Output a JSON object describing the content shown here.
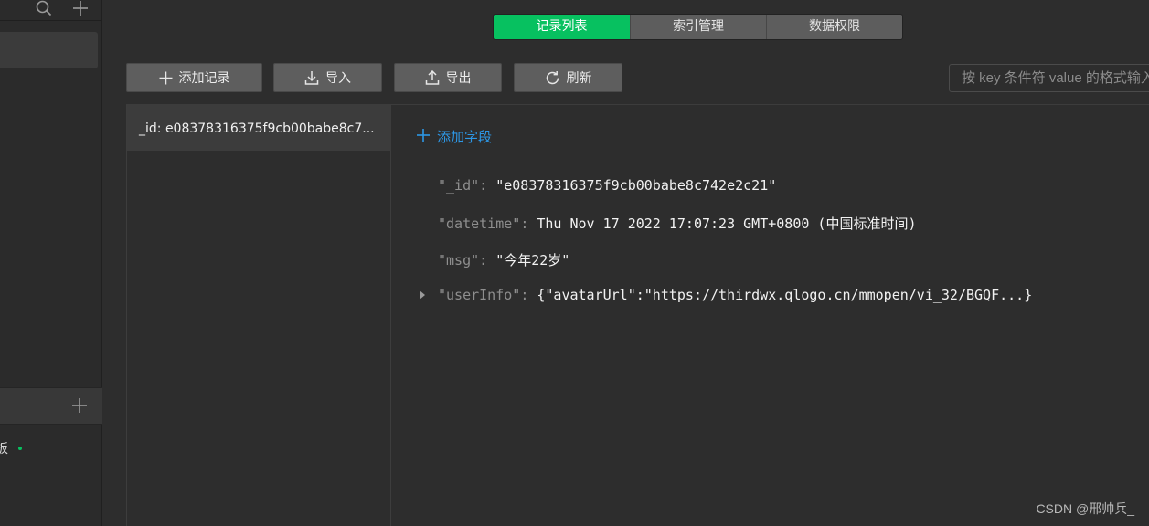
{
  "tabs": [
    {
      "label": "记录列表",
      "active": true
    },
    {
      "label": "索引管理",
      "active": false
    },
    {
      "label": "数据权限",
      "active": false
    }
  ],
  "toolbar": {
    "add_record": "添加记录",
    "import": "导入",
    "export": "导出",
    "refresh": "刷新",
    "search_placeholder": "按 key 条件符 value 的格式输入查询条件"
  },
  "sidebar": {
    "icons": [
      "search-icon",
      "plus-icon"
    ],
    "section_icon": "plus-icon",
    "item_fragment": "板",
    "status_color": "#07c160"
  },
  "records": [
    {
      "label": "_id: e08378316375f9cb00babe8c7..."
    }
  ],
  "detail": {
    "add_field_label": "添加字段",
    "fields": [
      {
        "key": "\"_id\"",
        "sep": ": ",
        "value": "\"e08378316375f9cb00babe8c742e2c21\""
      },
      {
        "key": "\"datetime\"",
        "sep": ": ",
        "value": "Thu Nov 17 2022 17:07:23 GMT+0800 (中国标准时间)"
      },
      {
        "key": "\"msg\"",
        "sep": ": ",
        "value": "\"今年22岁\""
      },
      {
        "key": "\"userInfo\"",
        "sep": ": ",
        "value": "{\"avatarUrl\":\"https://thirdwx.qlogo.cn/mmopen/vi_32/BGQF...}"
      }
    ]
  },
  "watermark": "CSDN @邢帅兵_",
  "colors": {
    "accent": "#07c160",
    "link": "#2d97e6",
    "background": "#2d2d2d"
  }
}
